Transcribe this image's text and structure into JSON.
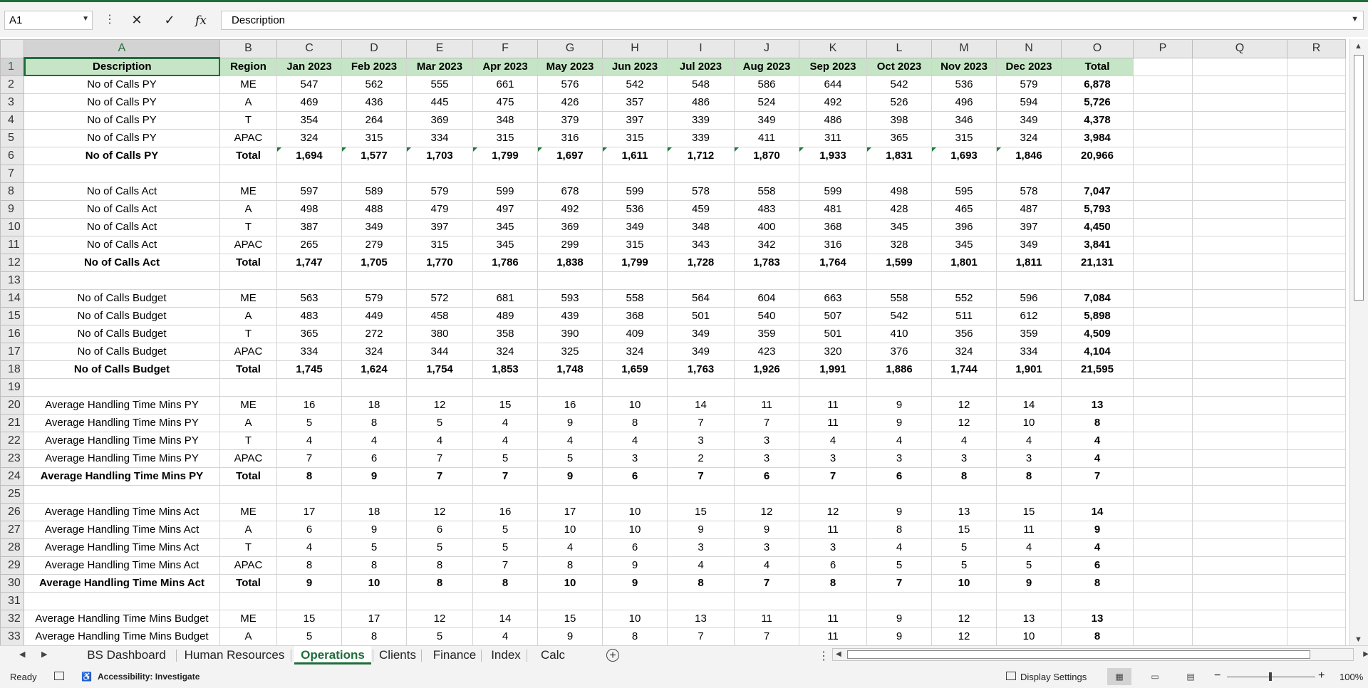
{
  "namebox": {
    "value": "A1"
  },
  "formula_bar": {
    "value": "Description",
    "fx_label": "fx"
  },
  "columns": [
    "A",
    "B",
    "C",
    "D",
    "E",
    "F",
    "G",
    "H",
    "I",
    "J",
    "K",
    "L",
    "M",
    "N",
    "O",
    "P",
    "Q",
    "R"
  ],
  "rows": [
    {
      "n": "1",
      "header": true,
      "cells": [
        "Description",
        "Region",
        "Jan 2023",
        "Feb 2023",
        "Mar 2023",
        "Apr 2023",
        "May 2023",
        "Jun 2023",
        "Jul 2023",
        "Aug 2023",
        "Sep 2023",
        "Oct 2023",
        "Nov 2023",
        "Dec 2023",
        "Total"
      ]
    },
    {
      "n": "2",
      "cells": [
        "No of Calls PY",
        "ME",
        "547",
        "562",
        "555",
        "661",
        "576",
        "542",
        "548",
        "586",
        "644",
        "542",
        "536",
        "579",
        "6,878"
      ]
    },
    {
      "n": "3",
      "cells": [
        "No of Calls PY",
        "A",
        "469",
        "436",
        "445",
        "475",
        "426",
        "357",
        "486",
        "524",
        "492",
        "526",
        "496",
        "594",
        "5,726"
      ]
    },
    {
      "n": "4",
      "cells": [
        "No of Calls PY",
        "T",
        "354",
        "264",
        "369",
        "348",
        "379",
        "397",
        "339",
        "349",
        "486",
        "398",
        "346",
        "349",
        "4,378"
      ]
    },
    {
      "n": "5",
      "cells": [
        "No of Calls PY",
        "APAC",
        "324",
        "315",
        "334",
        "315",
        "316",
        "315",
        "339",
        "411",
        "311",
        "365",
        "315",
        "324",
        "3,984"
      ]
    },
    {
      "n": "6",
      "bold": true,
      "flags": true,
      "cells": [
        "No of Calls PY",
        "Total",
        "1,694",
        "1,577",
        "1,703",
        "1,799",
        "1,697",
        "1,611",
        "1,712",
        "1,870",
        "1,933",
        "1,831",
        "1,693",
        "1,846",
        "20,966"
      ]
    },
    {
      "n": "7",
      "cells": []
    },
    {
      "n": "8",
      "cells": [
        "No of Calls Act",
        "ME",
        "597",
        "589",
        "579",
        "599",
        "678",
        "599",
        "578",
        "558",
        "599",
        "498",
        "595",
        "578",
        "7,047"
      ]
    },
    {
      "n": "9",
      "cells": [
        "No of Calls Act",
        "A",
        "498",
        "488",
        "479",
        "497",
        "492",
        "536",
        "459",
        "483",
        "481",
        "428",
        "465",
        "487",
        "5,793"
      ]
    },
    {
      "n": "10",
      "cells": [
        "No of Calls Act",
        "T",
        "387",
        "349",
        "397",
        "345",
        "369",
        "349",
        "348",
        "400",
        "368",
        "345",
        "396",
        "397",
        "4,450"
      ]
    },
    {
      "n": "11",
      "cells": [
        "No of Calls Act",
        "APAC",
        "265",
        "279",
        "315",
        "345",
        "299",
        "315",
        "343",
        "342",
        "316",
        "328",
        "345",
        "349",
        "3,841"
      ]
    },
    {
      "n": "12",
      "bold": true,
      "cells": [
        "No of Calls Act",
        "Total",
        "1,747",
        "1,705",
        "1,770",
        "1,786",
        "1,838",
        "1,799",
        "1,728",
        "1,783",
        "1,764",
        "1,599",
        "1,801",
        "1,811",
        "21,131"
      ]
    },
    {
      "n": "13",
      "cells": []
    },
    {
      "n": "14",
      "cells": [
        "No of Calls Budget",
        "ME",
        "563",
        "579",
        "572",
        "681",
        "593",
        "558",
        "564",
        "604",
        "663",
        "558",
        "552",
        "596",
        "7,084"
      ]
    },
    {
      "n": "15",
      "cells": [
        "No of Calls Budget",
        "A",
        "483",
        "449",
        "458",
        "489",
        "439",
        "368",
        "501",
        "540",
        "507",
        "542",
        "511",
        "612",
        "5,898"
      ]
    },
    {
      "n": "16",
      "cells": [
        "No of Calls Budget",
        "T",
        "365",
        "272",
        "380",
        "358",
        "390",
        "409",
        "349",
        "359",
        "501",
        "410",
        "356",
        "359",
        "4,509"
      ]
    },
    {
      "n": "17",
      "cells": [
        "No of Calls Budget",
        "APAC",
        "334",
        "324",
        "344",
        "324",
        "325",
        "324",
        "349",
        "423",
        "320",
        "376",
        "324",
        "334",
        "4,104"
      ]
    },
    {
      "n": "18",
      "bold": true,
      "cells": [
        "No of Calls Budget",
        "Total",
        "1,745",
        "1,624",
        "1,754",
        "1,853",
        "1,748",
        "1,659",
        "1,763",
        "1,926",
        "1,991",
        "1,886",
        "1,744",
        "1,901",
        "21,595"
      ]
    },
    {
      "n": "19",
      "cells": []
    },
    {
      "n": "20",
      "cells": [
        "Average Handling Time Mins PY",
        "ME",
        "16",
        "18",
        "12",
        "15",
        "16",
        "10",
        "14",
        "11",
        "11",
        "9",
        "12",
        "14",
        "13"
      ]
    },
    {
      "n": "21",
      "cells": [
        "Average Handling Time Mins PY",
        "A",
        "5",
        "8",
        "5",
        "4",
        "9",
        "8",
        "7",
        "7",
        "11",
        "9",
        "12",
        "10",
        "8"
      ]
    },
    {
      "n": "22",
      "cells": [
        "Average Handling Time Mins PY",
        "T",
        "4",
        "4",
        "4",
        "4",
        "4",
        "4",
        "3",
        "3",
        "4",
        "4",
        "4",
        "4",
        "4"
      ]
    },
    {
      "n": "23",
      "cells": [
        "Average Handling Time Mins PY",
        "APAC",
        "7",
        "6",
        "7",
        "5",
        "5",
        "3",
        "2",
        "3",
        "3",
        "3",
        "3",
        "3",
        "4"
      ]
    },
    {
      "n": "24",
      "bold": true,
      "cells": [
        "Average Handling Time Mins PY",
        "Total",
        "8",
        "9",
        "7",
        "7",
        "9",
        "6",
        "7",
        "6",
        "7",
        "6",
        "8",
        "8",
        "7"
      ]
    },
    {
      "n": "25",
      "cells": []
    },
    {
      "n": "26",
      "cells": [
        "Average Handling Time Mins Act",
        "ME",
        "17",
        "18",
        "12",
        "16",
        "17",
        "10",
        "15",
        "12",
        "12",
        "9",
        "13",
        "15",
        "14"
      ]
    },
    {
      "n": "27",
      "cells": [
        "Average Handling Time Mins Act",
        "A",
        "6",
        "9",
        "6",
        "5",
        "10",
        "10",
        "9",
        "9",
        "11",
        "8",
        "15",
        "11",
        "9"
      ]
    },
    {
      "n": "28",
      "cells": [
        "Average Handling Time Mins Act",
        "T",
        "4",
        "5",
        "5",
        "5",
        "4",
        "6",
        "3",
        "3",
        "3",
        "4",
        "5",
        "4",
        "4"
      ]
    },
    {
      "n": "29",
      "cells": [
        "Average Handling Time Mins Act",
        "APAC",
        "8",
        "8",
        "8",
        "7",
        "8",
        "9",
        "4",
        "4",
        "6",
        "5",
        "5",
        "5",
        "6"
      ]
    },
    {
      "n": "30",
      "bold": true,
      "cells": [
        "Average Handling Time Mins Act",
        "Total",
        "9",
        "10",
        "8",
        "8",
        "10",
        "9",
        "8",
        "7",
        "8",
        "7",
        "10",
        "9",
        "8"
      ]
    },
    {
      "n": "31",
      "cells": []
    },
    {
      "n": "32",
      "cells": [
        "Average Handling Time Mins Budget",
        "ME",
        "15",
        "17",
        "12",
        "14",
        "15",
        "10",
        "13",
        "11",
        "11",
        "9",
        "12",
        "13",
        "13"
      ]
    },
    {
      "n": "33",
      "cells": [
        "Average Handling Time Mins Budget",
        "A",
        "5",
        "8",
        "5",
        "4",
        "9",
        "8",
        "7",
        "7",
        "11",
        "9",
        "12",
        "10",
        "8"
      ]
    }
  ],
  "sheet_tabs": [
    "BS Dashboard",
    "Human Resources",
    "Operations",
    "Clients",
    "Finance",
    "Index",
    "Calc"
  ],
  "active_tab": "Operations",
  "status": {
    "ready": "Ready",
    "accessibility": "Accessibility: Investigate",
    "display_settings": "Display Settings",
    "zoom_minus": "−",
    "zoom_plus": "+",
    "zoom": "100%"
  },
  "colors": {
    "accent": "#1e6e3a",
    "header_fill": "#c6e5c6"
  }
}
